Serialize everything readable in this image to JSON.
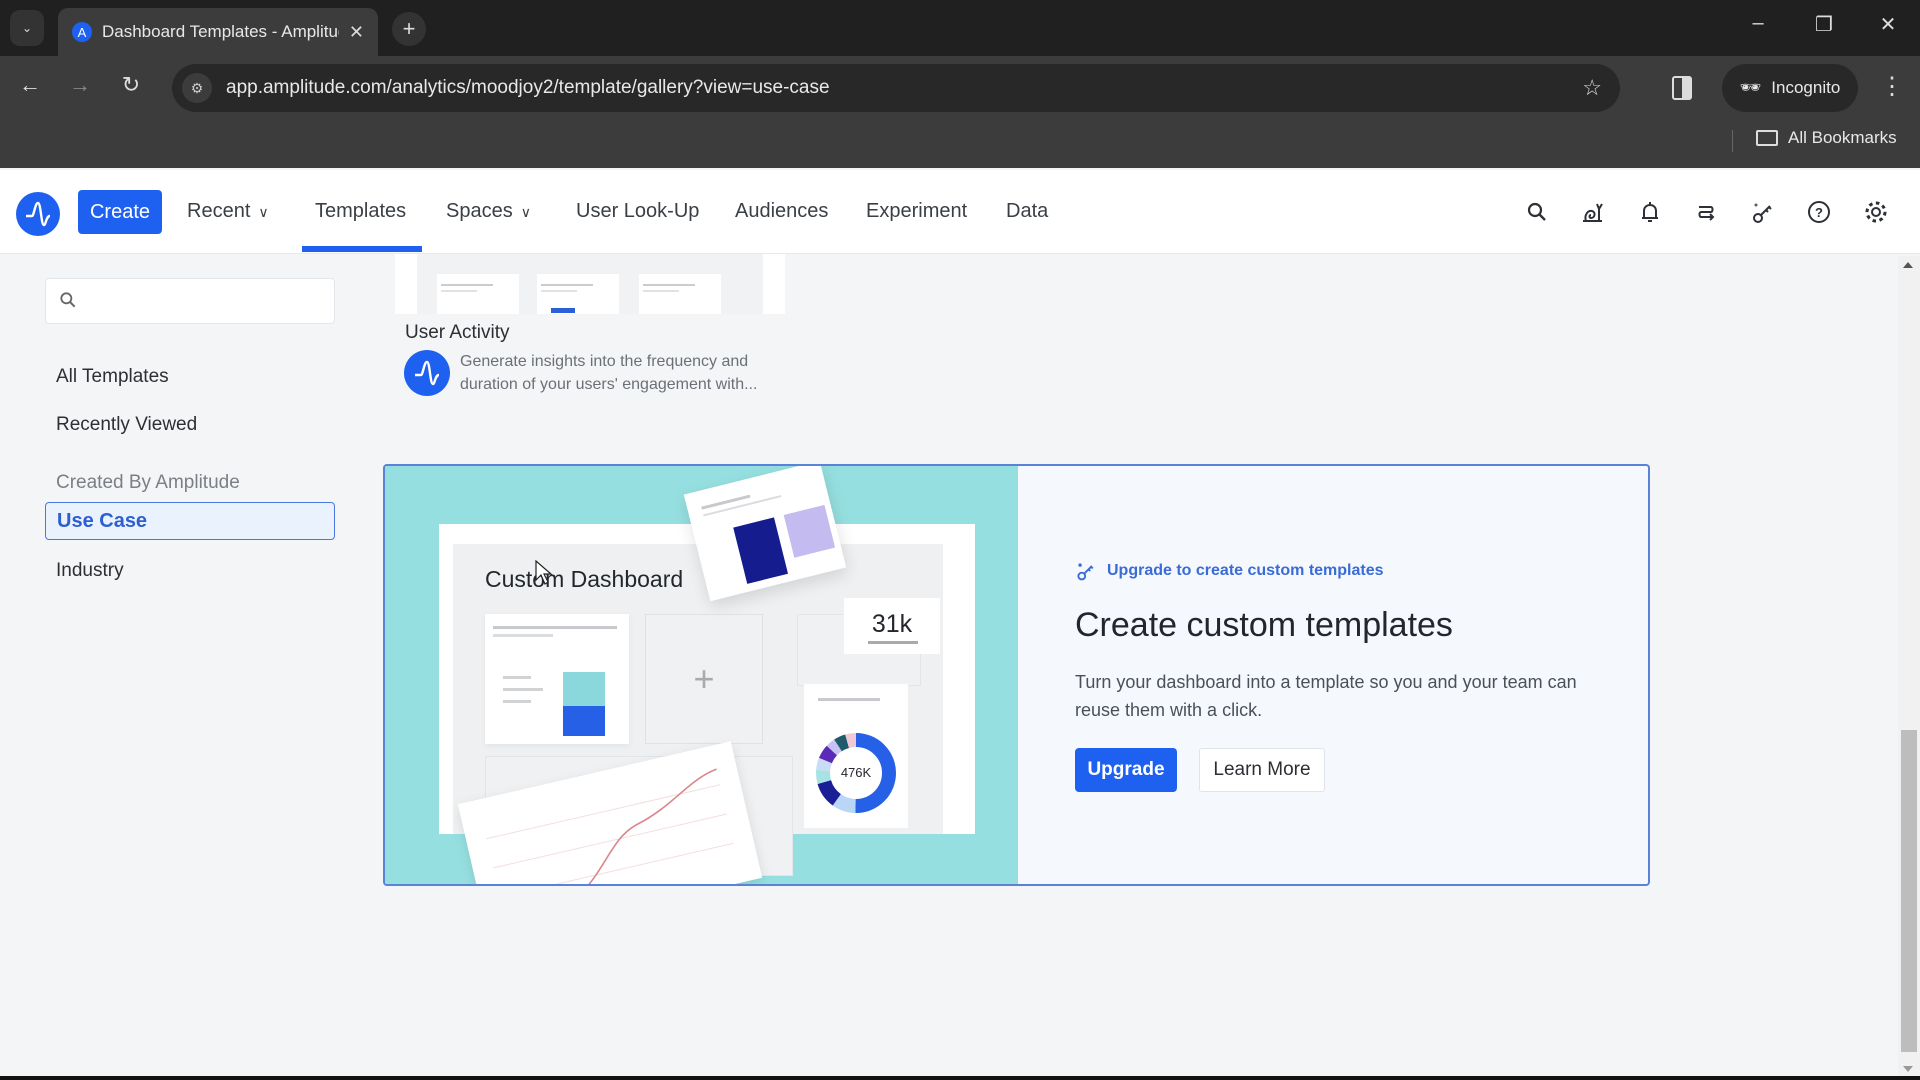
{
  "browser": {
    "tab_title": "Dashboard Templates - Amplitude",
    "tab_close": "✕",
    "new_tab": "+",
    "tab_search_icon": "⌄",
    "window_controls": {
      "minimize": "–",
      "restore": "❐",
      "close": "✕"
    },
    "nav": {
      "back": "←",
      "forward": "→",
      "reload": "↻"
    },
    "url": "app.amplitude.com/analytics/moodjoy2/template/gallery?view=use-case",
    "site_info_icon": "⚙",
    "bookmark_star": "☆",
    "incognito_label": "Incognito",
    "menu_icon": "⋮",
    "bookmarks_label": "All Bookmarks"
  },
  "header": {
    "logo_glyph": "A",
    "create_label": "Create",
    "nav": [
      {
        "label": "Recent",
        "has_dropdown": true
      },
      {
        "label": "Templates",
        "active": true
      },
      {
        "label": "Spaces",
        "has_dropdown": true
      },
      {
        "label": "User Look-Up"
      },
      {
        "label": "Audiences"
      },
      {
        "label": "Experiment"
      },
      {
        "label": "Data"
      }
    ],
    "chevron": "⌄",
    "icons": [
      "search-icon",
      "snail-icon",
      "bell-icon",
      "switch-icon",
      "key-sparkle-icon",
      "help-icon",
      "settings-icon"
    ]
  },
  "sidebar": {
    "search": {
      "value": "",
      "placeholder": ""
    },
    "items": [
      {
        "label": "All Templates"
      },
      {
        "label": "Recently Viewed"
      }
    ],
    "section_heading": "Created By Amplitude",
    "sub_items": [
      {
        "label": "Use Case",
        "active": true
      },
      {
        "label": "Industry"
      }
    ]
  },
  "template_card": {
    "title": "User Activity",
    "description": "Generate insights into the frequency and duration of your users' engagement with..."
  },
  "promo": {
    "illustration": {
      "dashboard_title": "Custom Dashboard",
      "kpi_value": "31k",
      "donut_label": "476K",
      "plus": "+"
    },
    "upgrade_link": "Upgrade to create custom templates",
    "heading": "Create custom templates",
    "description": "Turn your dashboard into a template so you and your team can reuse them with a click.",
    "upgrade_label": "Upgrade",
    "learn_more_label": "Learn More"
  },
  "colors": {
    "brand": "#1e61f0",
    "illustration_bg": "#96dfe0",
    "promo_border": "#5a82d6",
    "active_bg": "#eaf3fd"
  }
}
